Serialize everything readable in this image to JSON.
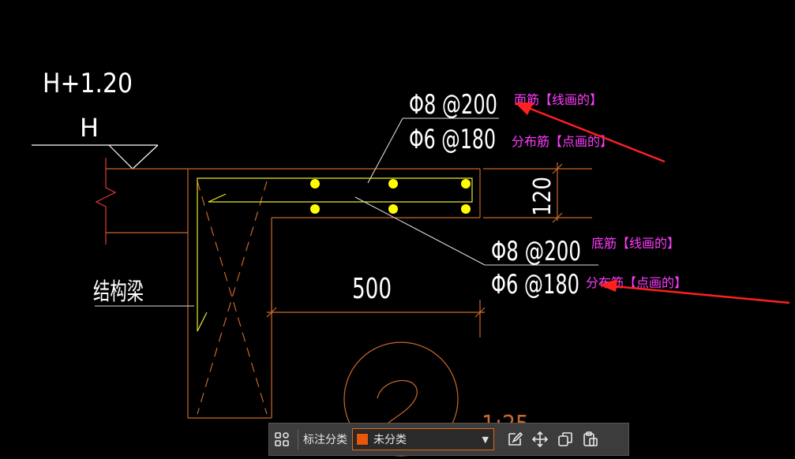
{
  "drawing": {
    "colors": {
      "outline": "#c8692a",
      "rebar_line": "#e8e82a",
      "rebar_dot": "#ffff00",
      "annotation_text": "#ffffff",
      "comment_text": "#ff3dff",
      "arrow": "#ff2020"
    },
    "level_top": "H+1.20",
    "level_base": "H",
    "labels": {
      "top_bar": "Φ8 @200",
      "top_dist": "Φ6 @180",
      "bottom_bar": "Φ8 @200",
      "bottom_dist": "Φ6 @180",
      "beam": "结构梁",
      "width_dim": "500",
      "thickness_dim": "120",
      "detail_no": "2",
      "scale_partial": "1:25"
    },
    "notes": {
      "top_main": "面筋【线画的】",
      "top_distribution": "分布筋【点画的】",
      "bottom_main": "底筋【线画的】",
      "bottom_distribution": "分布筋【点画的】"
    }
  },
  "toolbar": {
    "grid_icon": "grid-icon",
    "category_label": "标注分类",
    "category_value": "未分类",
    "category_color": "#e8580c",
    "icons": [
      "edit-icon",
      "move-icon",
      "copy-icon",
      "paste-icon"
    ]
  }
}
